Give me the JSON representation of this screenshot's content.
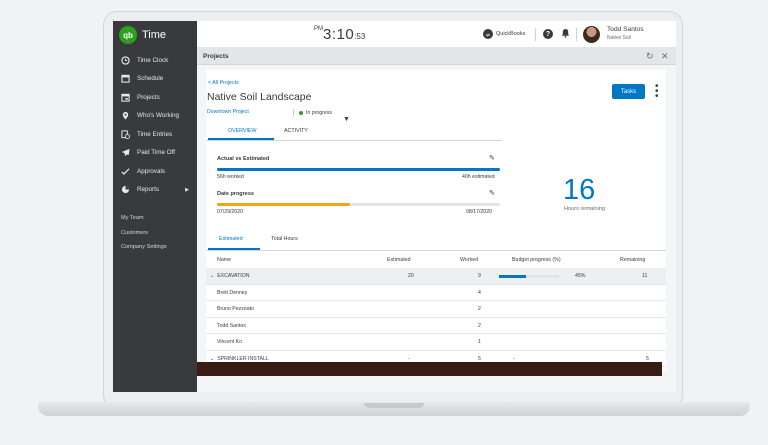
{
  "app": {
    "logo": "qb",
    "name": "Time"
  },
  "sidebar": {
    "items": [
      {
        "label": "Time Clock",
        "icon": "clock-icon"
      },
      {
        "label": "Schedule",
        "icon": "calendar-icon"
      },
      {
        "label": "Projects",
        "icon": "calendar-check-icon"
      },
      {
        "label": "Who's Working",
        "icon": "pin-icon"
      },
      {
        "label": "Time Entries",
        "icon": "entries-icon"
      },
      {
        "label": "Paid Time Off",
        "icon": "plane-icon"
      },
      {
        "label": "Approvals",
        "icon": "check-icon"
      },
      {
        "label": "Reports",
        "icon": "pie-icon"
      }
    ],
    "secondary": [
      "My Team",
      "Customers",
      "Company Settings"
    ]
  },
  "topbar": {
    "clock_ampm": "PM",
    "clock_hm": "3:10",
    "clock_sec": ":53",
    "quickbooks_label": "QuickBooks",
    "user_name": "Todd Santos",
    "user_company": "Native Soil"
  },
  "panel": {
    "title": "Projects"
  },
  "project": {
    "back_label": "< All Projects",
    "title": "Native Soil Landscape",
    "parent": "Downtown Project",
    "status": "In progress",
    "tasks_label": "Tasks"
  },
  "tabs": {
    "overview": "OVERVIEW",
    "activity": "ACTIVITY"
  },
  "metrics": {
    "actual_label": "Actual vs Estimated",
    "worked": "56h worked",
    "estimated": "40h estimated",
    "actual_progress": 1.0,
    "date_label": "Date progress",
    "start_date": "07/29/2020",
    "end_date": "08/17/2020",
    "date_progress": 0.47,
    "hours_remaining_value": "16",
    "hours_remaining_label": "Hours remaining"
  },
  "subtabs": {
    "estimated": "Estimated",
    "total": "Total Hours"
  },
  "table": {
    "headers": {
      "name": "Name",
      "estimated": "Estimated",
      "worked": "Worked",
      "budget": "Budget progress (%)",
      "remaining": "Remaining"
    },
    "rows": [
      {
        "name": "EXCAVATION",
        "estimated": "20",
        "worked": "9",
        "budget_pct": "45%",
        "budget_value": 0.45,
        "remaining": "11",
        "group": true
      },
      {
        "name": "Brett Denney",
        "estimated": "",
        "worked": "4",
        "budget_pct": "",
        "remaining": "",
        "group": false
      },
      {
        "name": "Bruno Pezzeato",
        "estimated": "",
        "worked": "2",
        "budget_pct": "",
        "remaining": "",
        "group": false
      },
      {
        "name": "Todd Santos",
        "estimated": "",
        "worked": "2",
        "budget_pct": "",
        "remaining": "",
        "group": false
      },
      {
        "name": "Vincent Ko",
        "estimated": "",
        "worked": "1",
        "budget_pct": "",
        "remaining": "",
        "group": false
      },
      {
        "name": "SPRINKLER INSTALL",
        "estimated": "-",
        "worked": "5",
        "budget_pct": "-",
        "remaining": "5",
        "group": true
      }
    ]
  },
  "colors": {
    "brand_green": "#2ca01c",
    "accent_blue": "#0077c5",
    "date_bar": "#f4a31c",
    "sidebar": "#393a3d"
  }
}
